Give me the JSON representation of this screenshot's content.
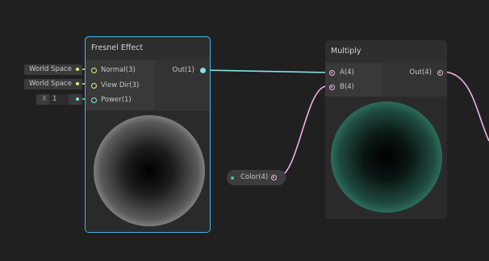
{
  "fresnel_node": {
    "title": "Fresnel Effect",
    "inputs": [
      "Normal(3)",
      "View Dir(3)",
      "Power(1)"
    ],
    "output": "Out(1)",
    "selected": true,
    "accent": "#4ab4e6"
  },
  "inline_inputs": {
    "normal_space": "World Space",
    "view_dir_space": "World Space",
    "power_axis": "X",
    "power_value": "1"
  },
  "multiply_node": {
    "title": "Multiply",
    "inputs": [
      "A(4)",
      "B(4)"
    ],
    "output": "Out(4)"
  },
  "color_node": {
    "label": "Color(4)",
    "color": "#4dbf9f"
  },
  "colors": {
    "vector3_port": "#f0f07a",
    "vector1_port": "#84e4e7",
    "dynamic_port": "#f0b0e4",
    "canvas_bg": "#202020"
  }
}
